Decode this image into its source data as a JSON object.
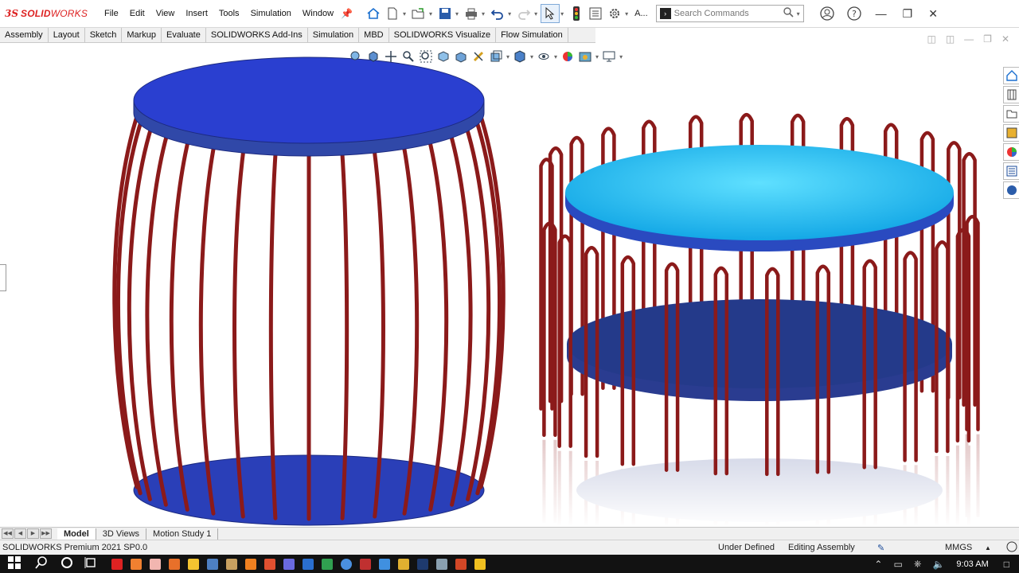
{
  "app": {
    "logo_prefix": "3S",
    "logo_bold": "SOLID",
    "logo_light": "WORKS"
  },
  "menu": [
    "File",
    "Edit",
    "View",
    "Insert",
    "Tools",
    "Simulation",
    "Window"
  ],
  "search": {
    "placeholder": "Search Commands",
    "truncated_label": "A..."
  },
  "command_tabs": [
    "Assembly",
    "Layout",
    "Sketch",
    "Markup",
    "Evaluate",
    "SOLIDWORKS Add-Ins",
    "Simulation",
    "MBD",
    "SOLIDWORKS Visualize",
    "Flow Simulation"
  ],
  "model_tabs": [
    "Model",
    "3D Views",
    "Motion Study 1"
  ],
  "status": {
    "product": "SOLIDWORKS Premium 2021 SP0.0",
    "state": "Under Defined",
    "mode": "Editing Assembly",
    "units": "MMGS"
  },
  "taskbar": {
    "time": "9:03 AM"
  },
  "colors": {
    "rod": "#8b1a1a",
    "disk_blue": "#2a3fb8",
    "disk_cyan": "#1fb8f0",
    "disk_dark": "#243a8a",
    "accent": "#1a6fcf"
  }
}
